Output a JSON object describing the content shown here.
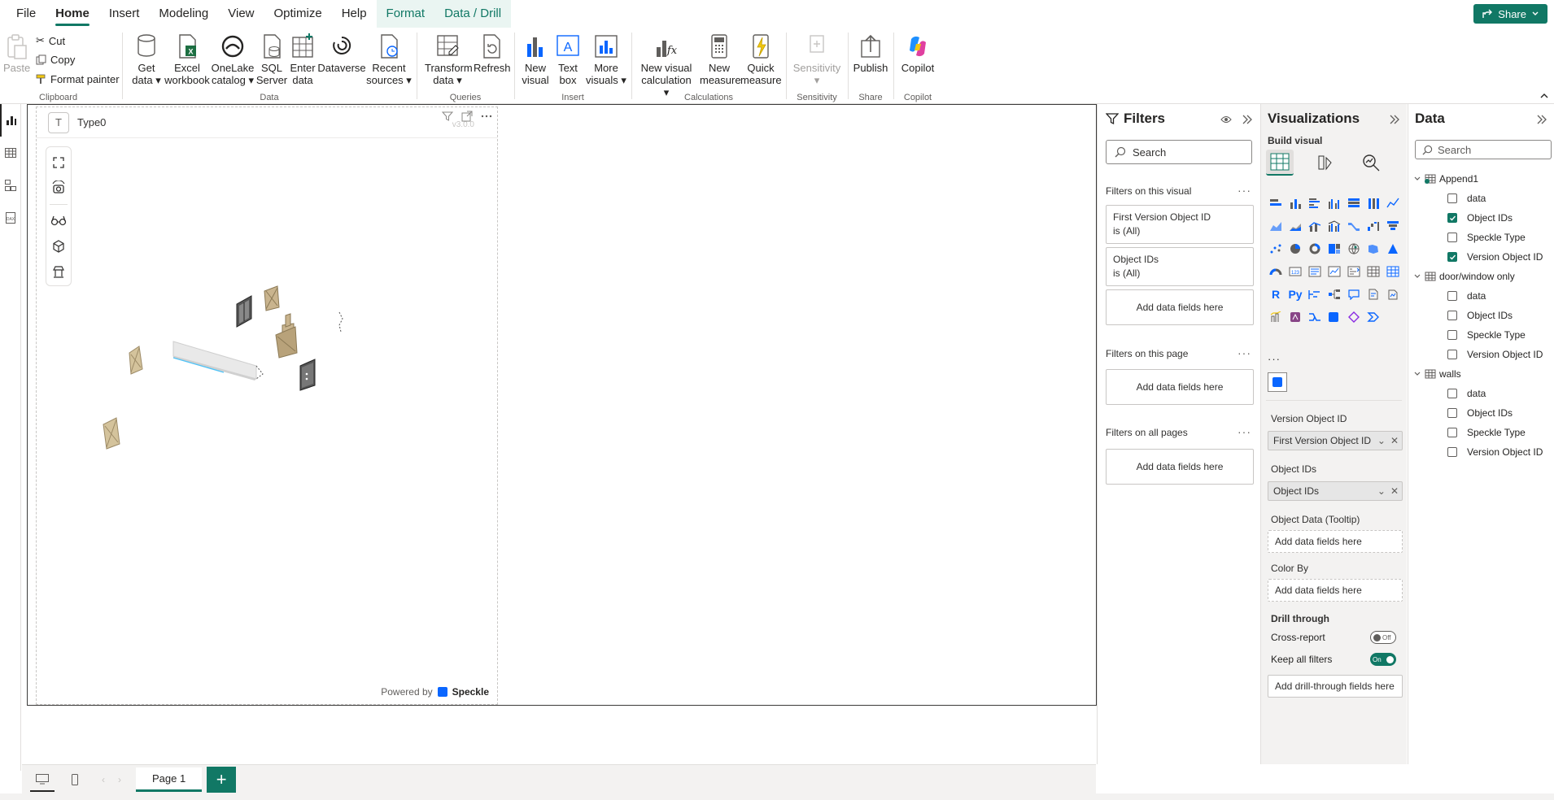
{
  "menu": {
    "tabs": [
      "File",
      "Home",
      "Insert",
      "Modeling",
      "View",
      "Optimize",
      "Help",
      "Format",
      "Data / Drill"
    ],
    "active": "Home",
    "share_label": "Share"
  },
  "ribbon": {
    "clipboard": {
      "paste": "Paste",
      "cut": "Cut",
      "copy": "Copy",
      "format_painter": "Format painter",
      "group": "Clipboard"
    },
    "data": {
      "get_data": [
        "Get",
        "data"
      ],
      "excel": [
        "Excel",
        "workbook"
      ],
      "onelake": [
        "OneLake",
        "catalog"
      ],
      "sql": [
        "SQL",
        "Server"
      ],
      "enter": [
        "Enter",
        "data"
      ],
      "dataverse": "Dataverse",
      "recent": [
        "Recent",
        "sources"
      ],
      "group": "Data"
    },
    "queries": {
      "transform": [
        "Transform",
        "data"
      ],
      "refresh": "Refresh",
      "group": "Queries"
    },
    "insert": {
      "new_visual": [
        "New",
        "visual"
      ],
      "text_box": [
        "Text",
        "box"
      ],
      "more_visuals": [
        "More",
        "visuals"
      ],
      "group": "Insert"
    },
    "calculations": {
      "new_visual_calc": [
        "New visual",
        "calculation"
      ],
      "new_measure": [
        "New",
        "measure"
      ],
      "quick_measure": [
        "Quick",
        "measure"
      ],
      "group": "Calculations"
    },
    "sensitivity": {
      "label": "Sensitivity",
      "group": "Sensitivity"
    },
    "share": {
      "publish": "Publish",
      "group": "Share"
    },
    "copilot": {
      "label": "Copilot",
      "group": "Copilot"
    }
  },
  "visual": {
    "type_letter": "T",
    "title": "Type0",
    "version": "v3.0.0",
    "powered_by": "Powered by",
    "brand": "Speckle"
  },
  "pages": {
    "tab": "Page 1",
    "add": "+"
  },
  "filters": {
    "title": "Filters",
    "search_placeholder": "Search",
    "on_visual": "Filters on this visual",
    "cards": [
      {
        "line1": "First Version Object ID",
        "line2": "is (All)"
      },
      {
        "line1": "Object IDs",
        "line2": "is (All)"
      }
    ],
    "add_fields": "Add data fields here",
    "on_page": "Filters on this page",
    "on_all": "Filters on all pages",
    "more": "···"
  },
  "visualizations": {
    "title": "Visualizations",
    "build_visual": "Build visual",
    "more": "···",
    "wells": {
      "version_label": "Version Object ID",
      "version_field": "First Version Object ID",
      "objects_label": "Object IDs",
      "objects_field": "Object IDs",
      "tooltip_label": "Object Data (Tooltip)",
      "tooltip_empty": "Add data fields here",
      "color_label": "Color By",
      "color_empty": "Add data fields here",
      "drill_label": "Drill through",
      "cross_report": "Cross-report",
      "cross_report_state": "Off",
      "keep_filters": "Keep all filters",
      "keep_filters_state": "On",
      "drill_empty": "Add drill-through fields here"
    },
    "grid_labels": {
      "r": "R",
      "py": "Py"
    }
  },
  "data_pane": {
    "title": "Data",
    "search_placeholder": "Search",
    "tables": [
      {
        "name": "Append1",
        "fields": [
          {
            "name": "data",
            "checked": false
          },
          {
            "name": "Object IDs",
            "checked": true
          },
          {
            "name": "Speckle Type",
            "checked": false
          },
          {
            "name": "Version Object ID",
            "checked": true
          }
        ]
      },
      {
        "name": "door/window only",
        "fields": [
          {
            "name": "data",
            "checked": false
          },
          {
            "name": "Object IDs",
            "checked": false
          },
          {
            "name": "Speckle Type",
            "checked": false
          },
          {
            "name": "Version Object ID",
            "checked": false
          }
        ]
      },
      {
        "name": "walls",
        "fields": [
          {
            "name": "data",
            "checked": false
          },
          {
            "name": "Object IDs",
            "checked": false
          },
          {
            "name": "Speckle Type",
            "checked": false
          },
          {
            "name": "Version Object ID",
            "checked": false
          }
        ]
      }
    ]
  },
  "colors": {
    "accent": "#117865",
    "speckle_blue": "#0a66ff",
    "pbi_yellow": "#f2c811"
  }
}
